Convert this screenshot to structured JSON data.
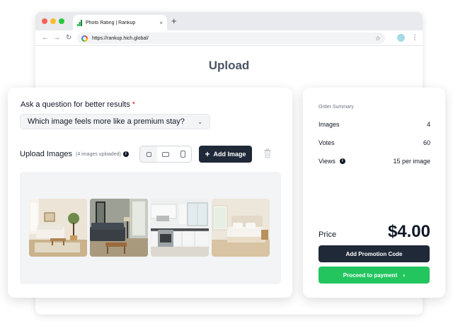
{
  "browser": {
    "tab_title": "Photo Rating | Rankup",
    "tab_close": "×",
    "new_tab": "+",
    "url": "https://rankup.hich.global/",
    "back": "←",
    "forward": "→",
    "reload": "↻",
    "star": "☆",
    "menu": "⋮"
  },
  "page": {
    "title": "Upload"
  },
  "question": {
    "label": "Ask a question for better results",
    "required_mark": "*",
    "selected": "Which image feels more like a premium stay?"
  },
  "upload": {
    "label": "Upload Images",
    "count_text": "(4 images uploaded)",
    "info": "i",
    "add_button": "Add Image",
    "add_plus": "+",
    "ratio_options": [
      "square",
      "landscape",
      "portrait"
    ],
    "active_ratio": "square"
  },
  "gallery": {
    "images": [
      {
        "alt": "living-room"
      },
      {
        "alt": "dark-living-room"
      },
      {
        "alt": "kitchen"
      },
      {
        "alt": "bedroom"
      }
    ]
  },
  "summary": {
    "title": "Order Summary",
    "images_label": "Images",
    "images_value": "4",
    "votes_label": "Votes",
    "votes_value": "60",
    "views_label": "Views",
    "views_info": "i",
    "views_value": "15 per image",
    "price_label": "Price",
    "price_value": "$4.00",
    "promo_button": "Add Promotion Code",
    "pay_button": "Proceed to payment",
    "pay_arrow": "›"
  },
  "colors": {
    "dark_button": "#1f2937",
    "pay_green": "#22c55e",
    "required_red": "#dc2626"
  }
}
